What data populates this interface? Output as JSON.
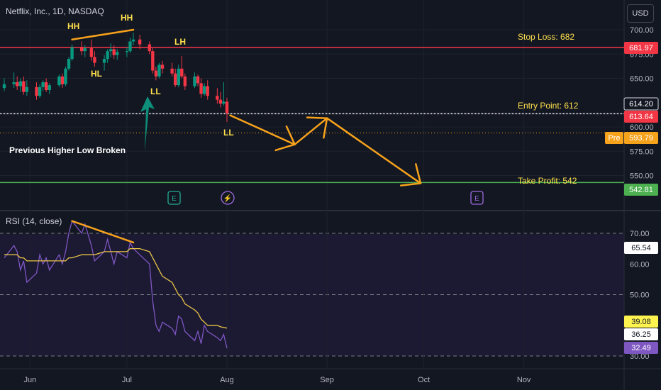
{
  "title": "Netflix, Inc., 1D, NASDAQ",
  "currency_button": "USD",
  "colors": {
    "background": "#131722",
    "up": "#089981",
    "down": "#f23645",
    "annotation": "#f7a21b",
    "label_text": "#ffe14d",
    "rsi_line": "#7e57c2",
    "rsi_ma": "#e8c547",
    "stop_line": "#f23645",
    "tp_line": "#4caf50"
  },
  "annotations": {
    "hh1": "HH",
    "hh2": "HH",
    "hl": "HL",
    "lh": "LH",
    "ll1": "LL",
    "ll2": "LL",
    "broken_note": "Previous Higher Low Broken",
    "stop_loss": "Stop Loss: 682",
    "entry_point": "Entry Point: 612",
    "take_profit": "Take Profit: 542"
  },
  "price_labels": {
    "stop": "681.97",
    "last_close": "614.20",
    "current": "613.64",
    "pre_tag": "Pre",
    "pre_price": "593.79",
    "take_profit": "542.81"
  },
  "event_icons": [
    {
      "icon": "earnings-icon",
      "label": "E",
      "date": "Jul 18"
    },
    {
      "icon": "dividend-split-icon",
      "label": "⚡",
      "date": "Jul 30"
    },
    {
      "icon": "earnings-icon",
      "label": "E",
      "date": "Oct 17"
    }
  ],
  "rsi_title": "RSI (14, close)",
  "rsi_labels": {
    "rsi_value": "65.54",
    "ma_value": "39.08",
    "mid_value": "36.25",
    "rsi_current": "32.49"
  },
  "chart_data": [
    {
      "type": "candlestick",
      "title": "Netflix, Inc., 1D, NASDAQ",
      "x_ticks": [
        "Jun",
        "Jul",
        "Aug",
        "Sep",
        "Oct",
        "Nov"
      ],
      "y_ticks": [
        550,
        575,
        600,
        650,
        675,
        700
      ],
      "ylim": [
        540,
        710
      ],
      "grid": true,
      "candles": [
        {
          "d": "May 24",
          "o": 640,
          "h": 650,
          "l": 637,
          "c": 644
        },
        {
          "d": "May 27",
          "o": 644,
          "h": 656,
          "l": 640,
          "c": 646
        },
        {
          "d": "May 28",
          "o": 646,
          "h": 652,
          "l": 638,
          "c": 642
        },
        {
          "d": "May 29",
          "o": 642,
          "h": 650,
          "l": 636,
          "c": 647
        },
        {
          "d": "May 30",
          "o": 647,
          "h": 652,
          "l": 633,
          "c": 636
        },
        {
          "d": "May 31",
          "o": 636,
          "h": 648,
          "l": 632,
          "c": 641
        },
        {
          "d": "Jun 3",
          "o": 641,
          "h": 646,
          "l": 628,
          "c": 632
        },
        {
          "d": "Jun 4",
          "o": 632,
          "h": 644,
          "l": 630,
          "c": 641
        },
        {
          "d": "Jun 5",
          "o": 641,
          "h": 648,
          "l": 637,
          "c": 646
        },
        {
          "d": "Jun 6",
          "o": 646,
          "h": 650,
          "l": 636,
          "c": 638
        },
        {
          "d": "Jun 7",
          "o": 638,
          "h": 645,
          "l": 634,
          "c": 643
        },
        {
          "d": "Jun 10",
          "o": 643,
          "h": 654,
          "l": 641,
          "c": 652
        },
        {
          "d": "Jun 11",
          "o": 652,
          "h": 655,
          "l": 640,
          "c": 644
        },
        {
          "d": "Jun 12",
          "o": 644,
          "h": 662,
          "l": 642,
          "c": 660
        },
        {
          "d": "Jun 13",
          "o": 660,
          "h": 672,
          "l": 658,
          "c": 670
        },
        {
          "d": "Jun 14",
          "o": 670,
          "h": 685,
          "l": 668,
          "c": 682
        },
        {
          "d": "Jun 17",
          "o": 682,
          "h": 688,
          "l": 674,
          "c": 678
        },
        {
          "d": "Jun 18",
          "o": 678,
          "h": 684,
          "l": 672,
          "c": 681
        },
        {
          "d": "Jun 20",
          "o": 681,
          "h": 690,
          "l": 668,
          "c": 672
        },
        {
          "d": "Jun 21",
          "o": 672,
          "h": 678,
          "l": 662,
          "c": 666
        },
        {
          "d": "Jun 24",
          "o": 666,
          "h": 674,
          "l": 658,
          "c": 670
        },
        {
          "d": "Jun 25",
          "o": 670,
          "h": 680,
          "l": 666,
          "c": 678
        },
        {
          "d": "Jun 26",
          "o": 678,
          "h": 686,
          "l": 672,
          "c": 680
        },
        {
          "d": "Jun 27",
          "o": 680,
          "h": 684,
          "l": 670,
          "c": 674
        },
        {
          "d": "Jun 28",
          "o": 674,
          "h": 680,
          "l": 669,
          "c": 677
        },
        {
          "d": "Jul 1",
          "o": 677,
          "h": 682,
          "l": 672,
          "c": 678
        },
        {
          "d": "Jul 2",
          "o": 678,
          "h": 692,
          "l": 676,
          "c": 688
        },
        {
          "d": "Jul 3",
          "o": 688,
          "h": 697,
          "l": 684,
          "c": 690
        },
        {
          "d": "Jul 5",
          "o": 690,
          "h": 695,
          "l": 680,
          "c": 685
        },
        {
          "d": "Jul 8",
          "o": 685,
          "h": 688,
          "l": 675,
          "c": 678
        },
        {
          "d": "Jul 9",
          "o": 678,
          "h": 681,
          "l": 655,
          "c": 658
        },
        {
          "d": "Jul 10",
          "o": 658,
          "h": 662,
          "l": 648,
          "c": 652
        },
        {
          "d": "Jul 11",
          "o": 652,
          "h": 666,
          "l": 650,
          "c": 664
        },
        {
          "d": "Jul 12",
          "o": 664,
          "h": 668,
          "l": 655,
          "c": 660
        },
        {
          "d": "Jul 15",
          "o": 660,
          "h": 666,
          "l": 652,
          "c": 655
        },
        {
          "d": "Jul 16",
          "o": 655,
          "h": 660,
          "l": 641,
          "c": 643
        },
        {
          "d": "Jul 17",
          "o": 643,
          "h": 664,
          "l": 641,
          "c": 660
        },
        {
          "d": "Jul 18",
          "o": 660,
          "h": 673,
          "l": 650,
          "c": 652
        },
        {
          "d": "Jul 19",
          "o": 652,
          "h": 655,
          "l": 638,
          "c": 642
        },
        {
          "d": "Jul 22",
          "o": 642,
          "h": 656,
          "l": 640,
          "c": 652
        },
        {
          "d": "Jul 23",
          "o": 652,
          "h": 654,
          "l": 642,
          "c": 645
        },
        {
          "d": "Jul 24",
          "o": 645,
          "h": 650,
          "l": 630,
          "c": 634
        },
        {
          "d": "Jul 25",
          "o": 634,
          "h": 645,
          "l": 632,
          "c": 642
        },
        {
          "d": "Jul 26",
          "o": 642,
          "h": 648,
          "l": 628,
          "c": 632
        },
        {
          "d": "Jul 29",
          "o": 632,
          "h": 640,
          "l": 624,
          "c": 628
        },
        {
          "d": "Jul 30",
          "o": 628,
          "h": 636,
          "l": 620,
          "c": 624
        },
        {
          "d": "Jul 31",
          "o": 624,
          "h": 646,
          "l": 622,
          "c": 626
        },
        {
          "d": "Aug 1",
          "o": 626,
          "h": 630,
          "l": 605,
          "c": 614
        }
      ],
      "levels": [
        {
          "name": "stop_loss",
          "value": 681.97
        },
        {
          "name": "entry",
          "value": 613.64
        },
        {
          "name": "take_profit",
          "value": 542.81
        },
        {
          "name": "premarket",
          "value": 593.79
        }
      ],
      "projection_path": [
        {
          "d": "Aug 2",
          "v": 612
        },
        {
          "d": "Aug 22",
          "v": 582
        },
        {
          "d": "Sep 1",
          "v": 609
        },
        {
          "d": "Sep 30",
          "v": 542
        }
      ],
      "trend_marks": [
        {
          "from": {
            "d": "Jun 14",
            "v": 690
          },
          "to": {
            "d": "Jul 3",
            "v": 700
          }
        }
      ]
    },
    {
      "type": "line",
      "title": "RSI (14, close)",
      "y_ticks": [
        30,
        50,
        60,
        70
      ],
      "ylim": [
        27,
        75
      ],
      "bands": [
        70,
        50,
        30
      ],
      "series": [
        {
          "name": "RSI",
          "values": [
            [
              "May 24",
              62
            ],
            [
              "May 27",
              66
            ],
            [
              "May 28",
              64
            ],
            [
              "May 29",
              58
            ],
            [
              "May 30",
              61
            ],
            [
              "May 31",
              54
            ],
            [
              "Jun 3",
              57
            ],
            [
              "Jun 4",
              63
            ],
            [
              "Jun 5",
              60
            ],
            [
              "Jun 6",
              62
            ],
            [
              "Jun 7",
              58
            ],
            [
              "Jun 10",
              63
            ],
            [
              "Jun 11",
              60
            ],
            [
              "Jun 12",
              64
            ],
            [
              "Jun 13",
              70
            ],
            [
              "Jun 14",
              74
            ],
            [
              "Jun 17",
              70
            ],
            [
              "Jun 18",
              73
            ],
            [
              "Jun 20",
              66
            ],
            [
              "Jun 21",
              61
            ],
            [
              "Jun 24",
              64
            ],
            [
              "Jun 25",
              68
            ],
            [
              "Jun 26",
              64
            ],
            [
              "Jun 27",
              60
            ],
            [
              "Jun 28",
              64
            ],
            [
              "Jul 1",
              62
            ],
            [
              "Jul 2",
              67
            ],
            [
              "Jul 3",
              65
            ],
            [
              "Jul 5",
              63
            ],
            [
              "Jul 8",
              60
            ],
            [
              "Jul 9",
              48
            ],
            [
              "Jul 10",
              40
            ],
            [
              "Jul 11",
              38
            ],
            [
              "Jul 12",
              41
            ],
            [
              "Jul 15",
              39
            ],
            [
              "Jul 16",
              37
            ],
            [
              "Jul 17",
              43
            ],
            [
              "Jul 18",
              42
            ],
            [
              "Jul 19",
              38
            ],
            [
              "Jul 22",
              35
            ],
            [
              "Jul 23",
              38
            ],
            [
              "Jul 24",
              34
            ],
            [
              "Jul 25",
              40
            ],
            [
              "Jul 26",
              38
            ],
            [
              "Jul 29",
              36
            ],
            [
              "Jul 30",
              35
            ],
            [
              "Jul 31",
              37
            ],
            [
              "Aug 1",
              32.49
            ]
          ]
        },
        {
          "name": "RSI-based MA",
          "values": [
            [
              "May 24",
              63
            ],
            [
              "May 27",
              63
            ],
            [
              "May 28",
              63
            ],
            [
              "May 29",
              62
            ],
            [
              "May 30",
              62
            ],
            [
              "May 31",
              61
            ],
            [
              "Jun 3",
              61
            ],
            [
              "Jun 4",
              61
            ],
            [
              "Jun 5",
              61
            ],
            [
              "Jun 6",
              61
            ],
            [
              "Jun 7",
              61
            ],
            [
              "Jun 10",
              61
            ],
            [
              "Jun 11",
              61
            ],
            [
              "Jun 12",
              61
            ],
            [
              "Jun 13",
              62
            ],
            [
              "Jun 14",
              62
            ],
            [
              "Jun 17",
              63
            ],
            [
              "Jun 18",
              63
            ],
            [
              "Jun 20",
              63
            ],
            [
              "Jun 21",
              63
            ],
            [
              "Jun 24",
              64
            ],
            [
              "Jun 25",
              64
            ],
            [
              "Jun 26",
              64
            ],
            [
              "Jun 27",
              64
            ],
            [
              "Jun 28",
              64
            ],
            [
              "Jul 1",
              64
            ],
            [
              "Jul 2",
              65
            ],
            [
              "Jul 3",
              65
            ],
            [
              "Jul 5",
              65
            ],
            [
              "Jul 8",
              64
            ],
            [
              "Jul 9",
              62
            ],
            [
              "Jul 10",
              60
            ],
            [
              "Jul 11",
              58
            ],
            [
              "Jul 12",
              56
            ],
            [
              "Jul 15",
              54
            ],
            [
              "Jul 16",
              52
            ],
            [
              "Jul 17",
              50
            ],
            [
              "Jul 18",
              49
            ],
            [
              "Jul 19",
              47
            ],
            [
              "Jul 22",
              45
            ],
            [
              "Jul 23",
              44
            ],
            [
              "Jul 24",
              42
            ],
            [
              "Jul 25",
              41
            ],
            [
              "Jul 26",
              40
            ],
            [
              "Jul 29",
              40
            ],
            [
              "Jul 30",
              39.5
            ],
            [
              "Jul 31",
              39.3
            ],
            [
              "Aug 1",
              39.08
            ]
          ]
        }
      ],
      "trend_marks": [
        {
          "from": {
            "d": "Jun 14",
            "v": 74
          },
          "to": {
            "d": "Jul 3",
            "v": 67
          }
        }
      ]
    }
  ]
}
